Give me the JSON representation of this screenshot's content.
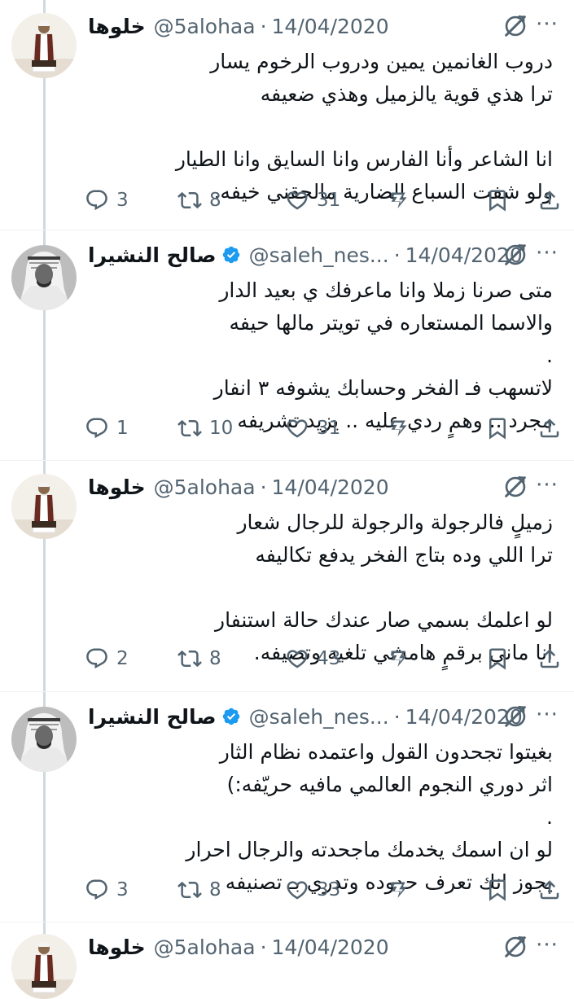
{
  "tweets": [
    {
      "name": "خلوها",
      "handle": "@5alohaa",
      "separator": "·",
      "date": "14/04/2020",
      "verified": false,
      "avatar": "man-in-traditional-dress-avatar",
      "lines": [
        "دروب الغانمين يمين ودروب الرخوم يسار",
        "ترا هذي قوية يالزميل وهذي ضعيفه",
        "",
        "انا الشاعر وأنا الفارس وانا السايق وانا الطيار",
        "ولو شفت السباع الضارية مالحقني خيفه."
      ],
      "replies": "3",
      "retweets": "8",
      "likes": "31"
    },
    {
      "name": "صالح النشيرا",
      "handle": "@saleh_nes...",
      "separator": "·",
      "date": "14/04/2020",
      "verified": true,
      "avatar": "man-in-ghutra-avatar",
      "lines": [
        "متى صرنا زملا وانا ماعرفك ي بعيد الدار",
        "والاسما المستعاره في  تويتر مالها حيفه",
        ".",
        "لاتسهب فـ الفخر وحسابك يشوفه ٣ انفار",
        "مجرد .. وهمٍ ردي عليه .. يزيد تشريفه"
      ],
      "replies": "1",
      "retweets": "10",
      "likes": "31"
    },
    {
      "name": "خلوها",
      "handle": "@5alohaa",
      "separator": "·",
      "date": "14/04/2020",
      "verified": false,
      "avatar": "man-in-traditional-dress-avatar",
      "lines": [
        "زميلٍ فالرجولة والرجولة للرجال شعار",
        "ترا اللي وده بتاج الفخر يدفع تكاليفه",
        "",
        "لو اعلمك بسمي صار عندك حالة استنفار",
        "انا ماني برقمٍ هامشي تلغيه وتضيفه."
      ],
      "replies": "2",
      "retweets": "8",
      "likes": "43"
    },
    {
      "name": "صالح النشيرا",
      "handle": "@saleh_nes...",
      "separator": "·",
      "date": "14/04/2020",
      "verified": true,
      "avatar": "man-in-ghutra-avatar",
      "lines": [
        "بغيتوا تجحدون القول واعتمده نظام الثار",
        "اثر دوري  النجوم العالمي مافيه حريّفه:)",
        ".",
        "لو ان اسمك يخدمك ماجحدته والرجال احرار",
        "يجوز انك تعرف حدوده وتدري بـ تصنيفه"
      ],
      "replies": "3",
      "retweets": "8",
      "likes": "33"
    },
    {
      "name": "خلوها",
      "handle": "@5alohaa",
      "separator": "·",
      "date": "14/04/2020",
      "verified": false,
      "avatar": "man-in-traditional-dress-avatar",
      "lines": [],
      "replies": "",
      "retweets": "",
      "likes": ""
    }
  ],
  "icons": {
    "reply": "reply-icon",
    "retweet": "retweet-icon",
    "like": "like-icon",
    "views": "views-icon",
    "bookmark": "bookmark-icon",
    "share": "share-icon",
    "grok": "grok-icon",
    "more": "more-icon",
    "verified": "verified-badge-icon"
  },
  "colors": {
    "text": "#0f1419",
    "secondary": "#536471",
    "verified_blue": "#1d9bf0",
    "thread_line": "#cfd9de"
  }
}
